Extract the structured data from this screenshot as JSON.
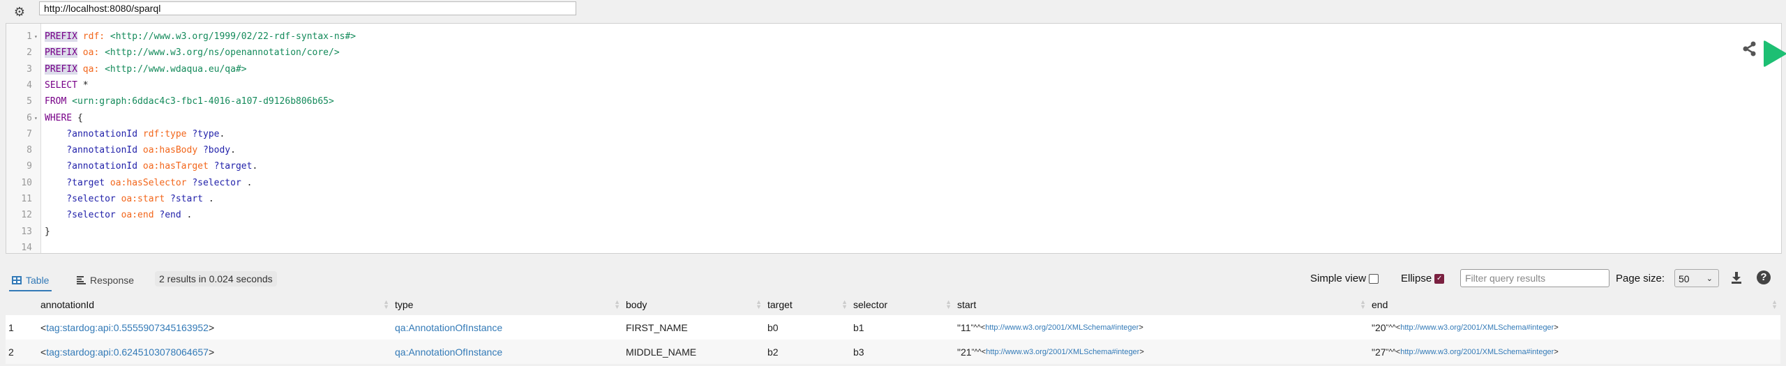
{
  "toolbar": {
    "settings_icon": "gear-icon",
    "endpoint_url": "http://localhost:8080/sparql"
  },
  "editor": {
    "lines": [
      {
        "n": "1",
        "fold": true,
        "tokens": [
          {
            "t": "PREFIX",
            "c": "kwh"
          },
          {
            "t": " rdf:",
            "c": "pfx"
          },
          {
            "t": " <http://www.w3.org/1999/02/22-rdf-syntax-ns#>",
            "c": "iri"
          }
        ]
      },
      {
        "n": "2",
        "tokens": [
          {
            "t": "PREFIX",
            "c": "kwh"
          },
          {
            "t": " oa:",
            "c": "pfx"
          },
          {
            "t": " <http://www.w3.org/ns/openannotation/core/>",
            "c": "iri"
          }
        ]
      },
      {
        "n": "3",
        "tokens": [
          {
            "t": "PREFIX",
            "c": "kwh"
          },
          {
            "t": " qa:",
            "c": "pfx"
          },
          {
            "t": " <http://www.wdaqua.eu/qa#>",
            "c": "iri"
          }
        ]
      },
      {
        "n": "4",
        "tokens": [
          {
            "t": "SELECT",
            "c": "kw"
          },
          {
            "t": " *",
            "c": "pun"
          }
        ]
      },
      {
        "n": "5",
        "tokens": [
          {
            "t": "FROM",
            "c": "kw"
          },
          {
            "t": " <urn:graph:6ddac4c3-fbc1-4016-a107-d9126b806b65>",
            "c": "iri"
          }
        ]
      },
      {
        "n": "6",
        "fold": true,
        "tokens": [
          {
            "t": "WHERE",
            "c": "kw"
          },
          {
            "t": " {",
            "c": "pun"
          }
        ]
      },
      {
        "n": "7",
        "tokens": [
          {
            "t": "    ?annotationId",
            "c": "var"
          },
          {
            "t": " rdf:type",
            "c": "pfx"
          },
          {
            "t": " ?type",
            "c": "var"
          },
          {
            "t": ".",
            "c": "pun"
          }
        ]
      },
      {
        "n": "8",
        "tokens": [
          {
            "t": "    ?annotationId",
            "c": "var"
          },
          {
            "t": " oa:hasBody",
            "c": "pfx"
          },
          {
            "t": " ?body",
            "c": "var"
          },
          {
            "t": ".",
            "c": "pun"
          }
        ]
      },
      {
        "n": "9",
        "tokens": [
          {
            "t": "    ?annotationId",
            "c": "var"
          },
          {
            "t": " oa:hasTarget",
            "c": "pfx"
          },
          {
            "t": " ?target",
            "c": "var"
          },
          {
            "t": ".",
            "c": "pun"
          }
        ]
      },
      {
        "n": "10",
        "tokens": [
          {
            "t": "    ?target",
            "c": "var"
          },
          {
            "t": " oa:hasSelector",
            "c": "pfx"
          },
          {
            "t": " ?selector",
            "c": "var"
          },
          {
            "t": " .",
            "c": "pun"
          }
        ]
      },
      {
        "n": "11",
        "tokens": [
          {
            "t": "    ?selector",
            "c": "var"
          },
          {
            "t": " oa:start",
            "c": "pfx"
          },
          {
            "t": " ?start",
            "c": "var"
          },
          {
            "t": " .",
            "c": "pun"
          }
        ]
      },
      {
        "n": "12",
        "tokens": [
          {
            "t": "    ?selector",
            "c": "var"
          },
          {
            "t": " oa:end",
            "c": "pfx"
          },
          {
            "t": " ?end",
            "c": "var"
          },
          {
            "t": " .",
            "c": "pun"
          }
        ]
      },
      {
        "n": "13",
        "tokens": [
          {
            "t": "}",
            "c": "pun"
          }
        ]
      },
      {
        "n": "14",
        "tokens": []
      }
    ],
    "share_icon": "share-icon",
    "run_icon": "play-icon",
    "run_color": "#1dbf73"
  },
  "results": {
    "tabs": [
      {
        "label": "Table",
        "icon": "table-icon",
        "active": true
      },
      {
        "label": "Response",
        "icon": "align-left-icon"
      }
    ],
    "summary": "2 results in 0.024 seconds",
    "simple_view_label": "Simple view",
    "simple_view_checked": false,
    "ellipse_label": "Ellipse",
    "ellipse_checked": true,
    "filter_placeholder": "Filter query results",
    "page_size_label": "Page size:",
    "page_size_value": "50",
    "download_icon": "download-icon",
    "help_icon": "question-circle-icon",
    "help_glyph": "?",
    "columns": [
      "",
      "annotationId",
      "type",
      "body",
      "target",
      "selector",
      "start",
      "end"
    ],
    "rows": [
      {
        "index": "1",
        "annotationId": "tag:stardog:api:0.5555907345163952",
        "type": "qa:AnnotationOfInstance",
        "body": "FIRST_NAME",
        "target": "b0",
        "selector": "b1",
        "start": "11",
        "end": "20",
        "datatype": "http://www.w3.org/2001/XMLSchema#integer"
      },
      {
        "index": "2",
        "annotationId": "tag:stardog:api:0.6245103078064657",
        "type": "qa:AnnotationOfInstance",
        "body": "MIDDLE_NAME",
        "target": "b2",
        "selector": "b3",
        "start": "21",
        "end": "27",
        "datatype": "http://www.w3.org/2001/XMLSchema#integer"
      }
    ]
  }
}
